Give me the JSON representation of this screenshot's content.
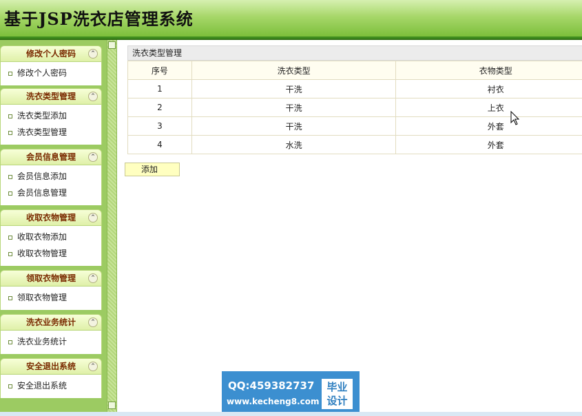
{
  "app": {
    "title": "基于JSP洗衣店管理系统"
  },
  "sidebar": {
    "groups": [
      {
        "title": "修改个人密码",
        "items": [
          "修改个人密码"
        ]
      },
      {
        "title": "洗衣类型管理",
        "items": [
          "洗衣类型添加",
          "洗衣类型管理"
        ]
      },
      {
        "title": "会员信息管理",
        "items": [
          "会员信息添加",
          "会员信息管理"
        ]
      },
      {
        "title": "收取衣物管理",
        "items": [
          "收取衣物添加",
          "收取衣物管理"
        ]
      },
      {
        "title": "领取衣物管理",
        "items": [
          "领取衣物管理"
        ]
      },
      {
        "title": "洗衣业务统计",
        "items": [
          "洗衣业务统计"
        ]
      },
      {
        "title": "安全退出系统",
        "items": [
          "安全退出系统"
        ]
      }
    ],
    "toggle_glyph": "⌃"
  },
  "main": {
    "panel_title": "洗衣类型管理",
    "table": {
      "headers": [
        "序号",
        "洗衣类型",
        "衣物类型"
      ],
      "rows": [
        [
          "1",
          "干洗",
          "衬衣"
        ],
        [
          "2",
          "干洗",
          "上衣"
        ],
        [
          "3",
          "干洗",
          "外套"
        ],
        [
          "4",
          "水洗",
          "外套"
        ]
      ]
    },
    "add_label": "添加"
  },
  "watermark": {
    "qq": "QQ:459382737",
    "url": "www.kecheng8.com",
    "badge_line1": "毕业",
    "badge_line2": "设计"
  },
  "colors": {
    "header_green": "#7cbf3b",
    "sidebar_green": "#9ccb62",
    "menu_title_text": "#7a2a00",
    "add_button": "#ffffc0",
    "watermark_blue": "#3c8fd0"
  }
}
